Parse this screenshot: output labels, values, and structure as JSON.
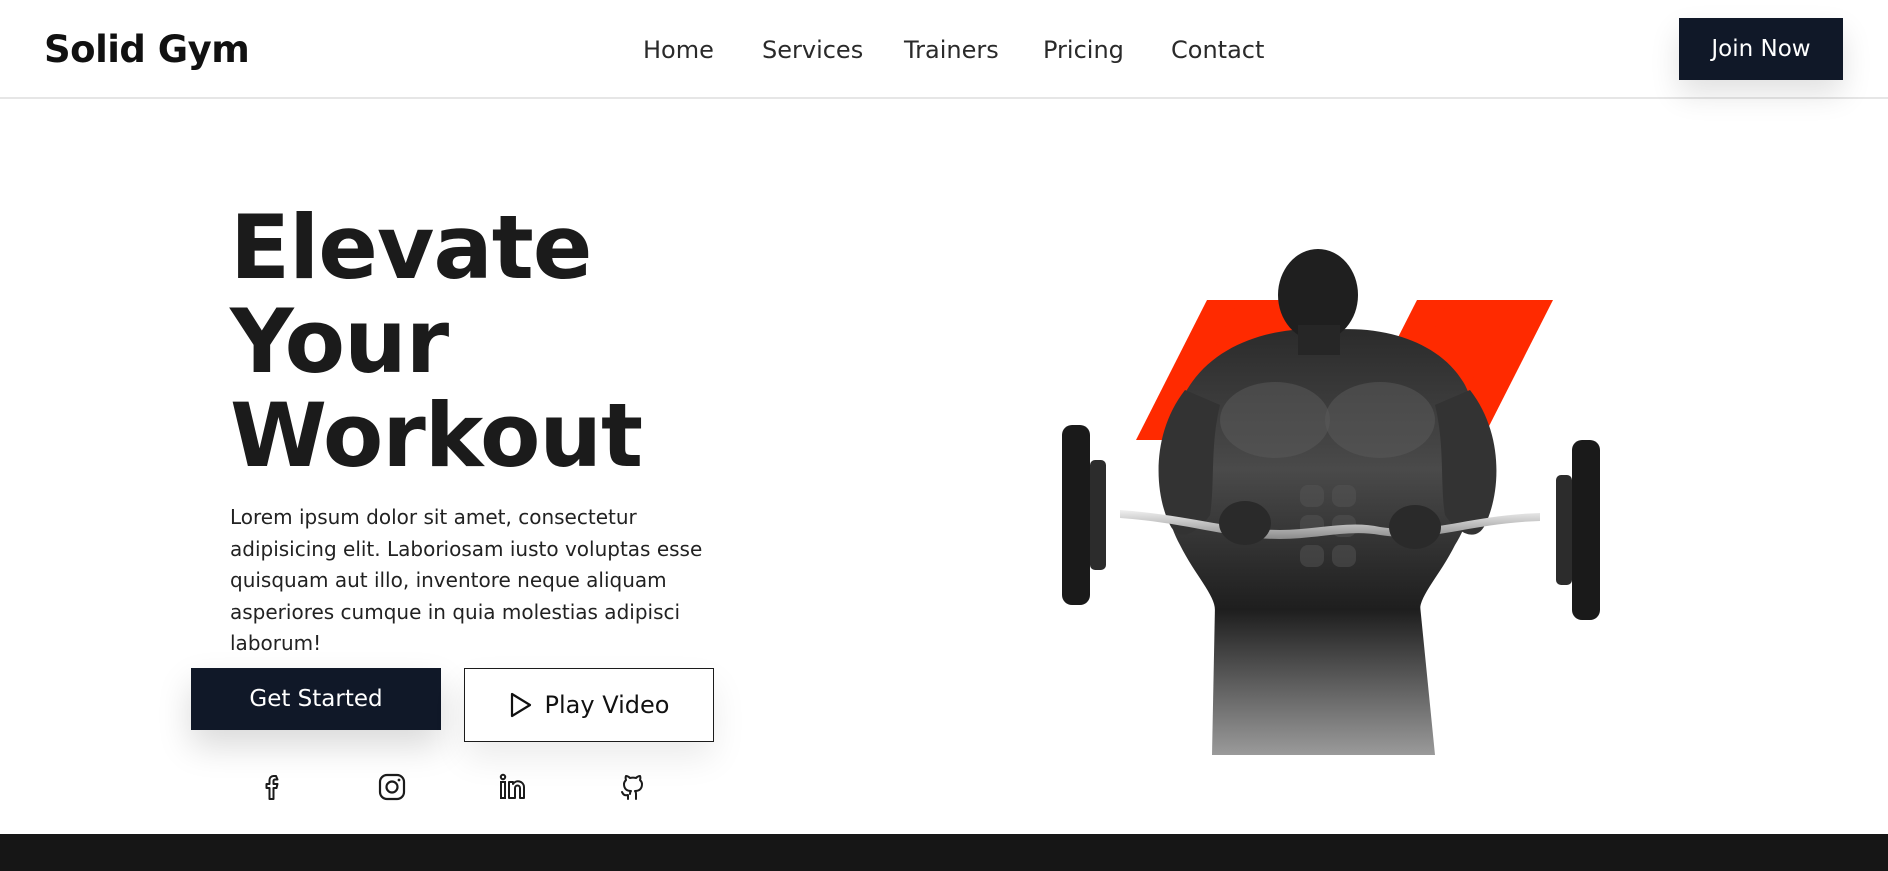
{
  "header": {
    "logo": "Solid Gym",
    "nav": [
      "Home",
      "Services",
      "Trainers",
      "Pricing",
      "Contact"
    ],
    "cta_label": "Join Now"
  },
  "hero": {
    "title_lines": [
      "Elevate",
      "Your",
      "Workout"
    ],
    "description": "Lorem ipsum dolor sit amet, consectetur adipisicing elit. Laboriosam iusto voluptas esse quisquam aut illo, inventore neque aliquam asperiores cumque in quia molestias adipisci laborum!",
    "primary_label": "Get Started",
    "secondary_label": "Play Video",
    "secondary_icon": "play-icon"
  },
  "socials": [
    {
      "name": "facebook-icon"
    },
    {
      "name": "instagram-icon"
    },
    {
      "name": "linkedin-icon"
    },
    {
      "name": "github-icon"
    }
  ],
  "colors": {
    "dark": "#101828",
    "accent": "#ff2a00",
    "text": "#1b1b1b",
    "footer": "#161616"
  }
}
